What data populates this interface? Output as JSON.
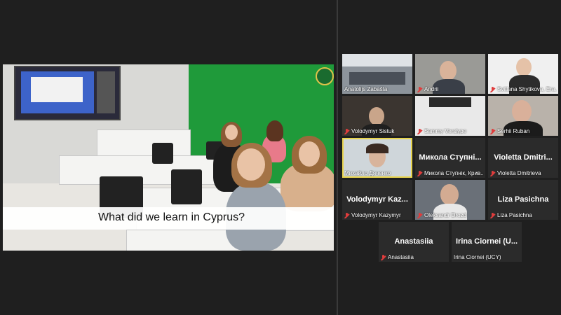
{
  "shared_screen": {
    "caption": "What did we learn in Cyprus?"
  },
  "participants": [
    {
      "name": "Anatolijs Zabašta",
      "muted": false,
      "video": true,
      "big_label": ""
    },
    {
      "name": "Andrii",
      "muted": true,
      "video": true,
      "big_label": ""
    },
    {
      "name": "Svitlana Shytikova, Era...",
      "muted": true,
      "video": true,
      "big_label": ""
    },
    {
      "name": "Volodymyr Sistuk",
      "muted": true,
      "video": true,
      "big_label": ""
    },
    {
      "name": "Sammy Verslype",
      "muted": true,
      "video": true,
      "big_label": ""
    },
    {
      "name": "Serhii Ruban",
      "muted": true,
      "video": true,
      "big_label": ""
    },
    {
      "name": "Михайло Дяченко",
      "muted": false,
      "video": true,
      "big_label": "",
      "active": true
    },
    {
      "name": "Микола Ступнік, Крив...",
      "muted": true,
      "video": false,
      "big_label": "Микола  Ступні..."
    },
    {
      "name": "Violetta Dmitrieva",
      "muted": true,
      "video": false,
      "big_label": "Violetta  Dmitri..."
    },
    {
      "name": "Volodymyr Kazymyr",
      "muted": true,
      "video": false,
      "big_label": "Volodymyr  Kaz..."
    },
    {
      "name": "Oleksandr Drozd",
      "muted": true,
      "video": true,
      "big_label": ""
    },
    {
      "name": "Liza Pasichna",
      "muted": true,
      "video": false,
      "big_label": "Liza Pasichna"
    },
    {
      "name": "Anastasiia",
      "muted": true,
      "video": false,
      "big_label": "Anastasiia"
    },
    {
      "name": "Irina Ciornei (UCY)",
      "muted": false,
      "video": false,
      "big_label": "Irina Ciornei (U..."
    }
  ]
}
